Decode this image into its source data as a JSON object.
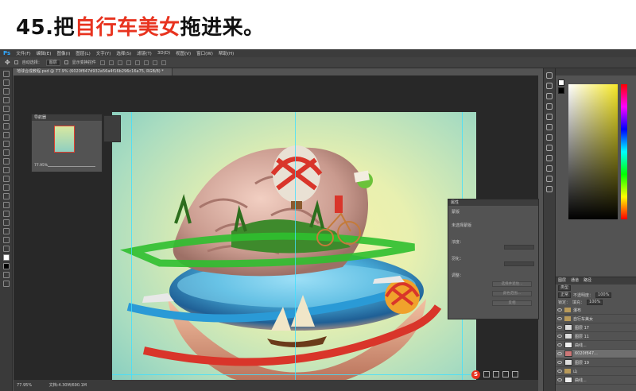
{
  "heading": {
    "prefix": "45.把",
    "highlight": "自行车美女",
    "suffix": "拖进来。"
  },
  "app": {
    "logo": "Ps",
    "menu": [
      "文件(F)",
      "编辑(E)",
      "图像(I)",
      "图层(L)",
      "文字(Y)",
      "选择(S)",
      "滤镜(T)",
      "3D(D)",
      "视图(V)",
      "窗口(W)",
      "帮助(H)"
    ],
    "options": {
      "auto_select_label": "自动选择：",
      "auto_select_value": "图层",
      "show_transform_label": "显示变换控件"
    },
    "document_tab": "地球合成教程.psd @ 77.9% (6020f847d932a56a4f16b296c16a75, RGB/8) *",
    "status_zoom": "77.95%",
    "status_doc": "文档:4.30M/690.1M"
  },
  "navigator": {
    "title": "导航器",
    "zoom": "77.95%"
  },
  "properties": {
    "title": "属性",
    "mode": "蒙版",
    "mask_label": "未选择蒙版",
    "density_label": "浓度：",
    "feather_label": "羽化：",
    "refine_label": "调整：",
    "mask_edge_button": "选择并遮住...",
    "color_range_button": "颜色范围...",
    "invert_button": "反相"
  },
  "colors": {
    "accent_red": "#e8331f",
    "guide_cyan": "#40e0ff",
    "picker_hue": "#f7e928"
  },
  "layers": {
    "tabs": [
      "图层",
      "通道",
      "路径"
    ],
    "kind_label": "类型",
    "blend_mode": "正常",
    "opacity_label": "不透明度：",
    "opacity_value": "100%",
    "lock_label": "锁定：",
    "fill_label": "填充：",
    "fill_value": "100%",
    "items": [
      {
        "name": "瀑布",
        "type": "group"
      },
      {
        "name": "自行车美女",
        "type": "group"
      },
      {
        "name": "图层 17",
        "type": "layer"
      },
      {
        "name": "图层 11",
        "type": "layer"
      },
      {
        "name": "曲线...",
        "type": "adjustment"
      },
      {
        "name": "6020f847...",
        "type": "layer",
        "selected": true
      },
      {
        "name": "图层 19",
        "type": "layer"
      },
      {
        "name": "山",
        "type": "group"
      },
      {
        "name": "曲线...",
        "type": "adjustment"
      }
    ]
  }
}
